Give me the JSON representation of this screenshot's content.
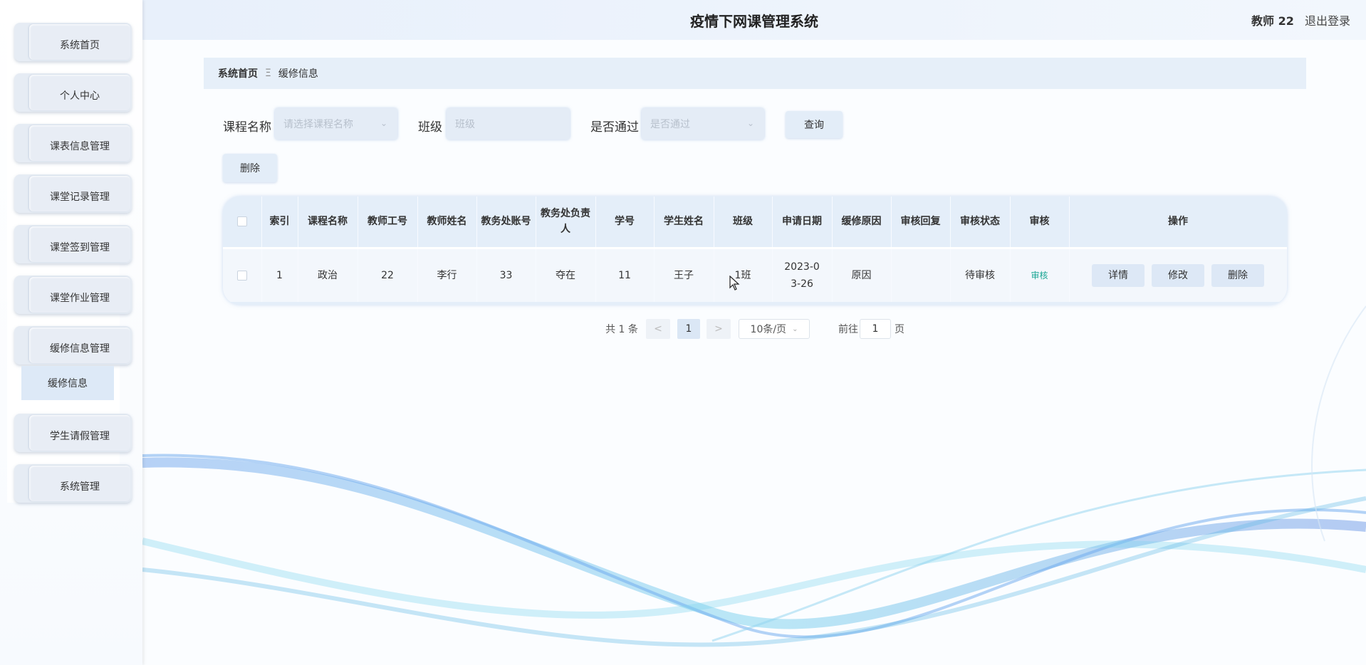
{
  "header": {
    "title": "疫情下网课管理系统",
    "user_name": "教师 22",
    "logout_label": "退出登录"
  },
  "sidebar": {
    "items": [
      {
        "label": "系统首页"
      },
      {
        "label": "个人中心"
      },
      {
        "label": "课表信息管理"
      },
      {
        "label": "课堂记录管理"
      },
      {
        "label": "课堂签到管理"
      },
      {
        "label": "课堂作业管理"
      },
      {
        "label": "缓修信息管理"
      },
      {
        "label": "学生请假管理"
      },
      {
        "label": "系统管理"
      }
    ],
    "active_sub": "缓修信息"
  },
  "breadcrumb": {
    "home": "系统首页",
    "separator": "Ξ",
    "current": "缓修信息"
  },
  "search": {
    "course_label": "课程名称",
    "course_placeholder": "请选择课程名称",
    "class_label": "班级",
    "class_placeholder": "班级",
    "passed_label": "是否通过",
    "passed_placeholder": "是否通过",
    "query_label": "查询",
    "delete_label": "删除"
  },
  "table": {
    "headers": [
      "索引",
      "课程名称",
      "教师工号",
      "教师姓名",
      "教务处账号",
      "教务处负责人",
      "学号",
      "学生姓名",
      "班级",
      "申请日期",
      "缓修原因",
      "审核回复",
      "审核状态",
      "审核",
      "操作"
    ],
    "rows": [
      {
        "index": "1",
        "course": "政治",
        "teacher_id": "22",
        "teacher_name": "李行",
        "office_account": "33",
        "office_head": "夺在",
        "student_id": "11",
        "student_name": "王子",
        "class": "1班",
        "apply_date": "2023-03-26",
        "reason": "原因",
        "reply": "",
        "status": "待审核",
        "audit_label": "审核",
        "detail_label": "详情",
        "edit_label": "修改",
        "delete_label": "删除"
      }
    ]
  },
  "pagination": {
    "total_text": "共 1 条",
    "prev": "<",
    "current_page": "1",
    "next": ">",
    "page_size": "10条/页",
    "goto_label": "前往",
    "goto_value": "1",
    "page_suffix": "页"
  },
  "colors": {
    "accent": "#e4eef9",
    "audit_link": "#1aa694"
  }
}
